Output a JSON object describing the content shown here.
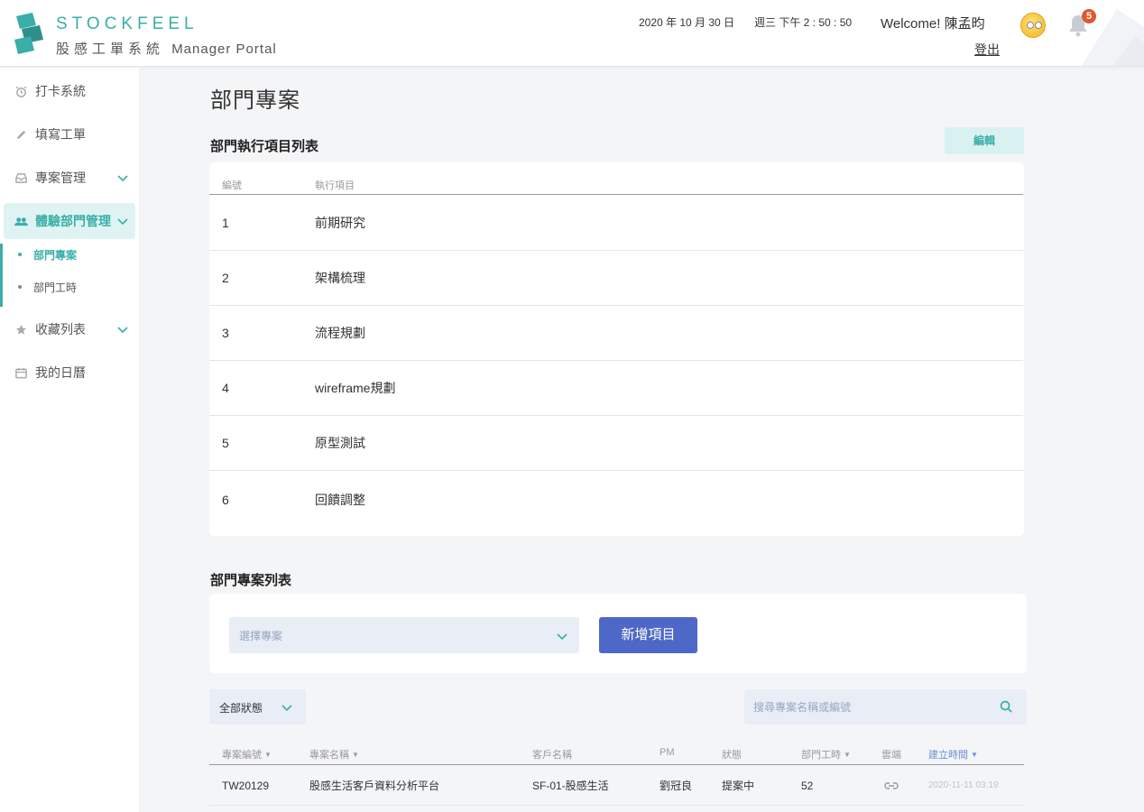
{
  "header": {
    "brand_en": "STOCKFEEL",
    "brand_zh": "股感工單系統",
    "brand_sub": "Manager Portal",
    "date": "2020 年 10 月 30 日",
    "time": "週三 下午 2 : 50 : 50",
    "welcome": "Welcome!  陳孟昀",
    "logout": "登出",
    "notification_count": "5",
    "accent_color": "#3aaea8",
    "icons": [
      "logo-mark",
      "emoji-avatar",
      "bell-icon"
    ]
  },
  "sidebar": {
    "items": [
      {
        "label": "打卡系統",
        "icon": "alarm-clock-icon"
      },
      {
        "label": "填寫工單",
        "icon": "pencil-icon"
      },
      {
        "label": "專案管理",
        "icon": "inbox-icon",
        "expandable": true
      },
      {
        "label": "體驗部門管理",
        "icon": "users-icon",
        "expandable": true,
        "active": true
      },
      {
        "label": "收藏列表",
        "icon": "star-icon",
        "expandable": true
      },
      {
        "label": "我的日曆",
        "icon": "calendar-icon"
      }
    ],
    "subitems": [
      {
        "label": "部門專案",
        "active": true
      },
      {
        "label": "部門工時",
        "active": false
      }
    ]
  },
  "main": {
    "page_title": "部門專案",
    "exec_section": {
      "title": "部門執行項目列表",
      "edit_label": "編輯",
      "columns": [
        "編號",
        "執行項目"
      ],
      "rows": [
        [
          "1",
          "前期研究"
        ],
        [
          "2",
          "架構梳理"
        ],
        [
          "3",
          "流程規劃"
        ],
        [
          "4",
          "wireframe規劃"
        ],
        [
          "5",
          "原型測試"
        ],
        [
          "6",
          "回饋調整"
        ]
      ]
    },
    "project_section": {
      "title": "部門專案列表",
      "select_placeholder": "選擇專案",
      "add_label": "新增項目",
      "status_filter": "全部狀態",
      "search_placeholder": "搜尋專案名稱或編號",
      "columns": [
        "專案編號",
        "專案名稱",
        "客戶名稱",
        "PM",
        "狀態",
        "部門工時",
        "雲端",
        "建立時間"
      ],
      "sort_active_color": "#6d8fd6",
      "rows": [
        {
          "id": "TW20129",
          "name": "股感生活客戶資料分析平台",
          "client": "SF-01-股感生活",
          "pm": "劉冠良",
          "status": "提案中",
          "hours": "52",
          "cloud_icon": "link-icon",
          "created": "2020-11-11 03:19"
        }
      ]
    }
  }
}
